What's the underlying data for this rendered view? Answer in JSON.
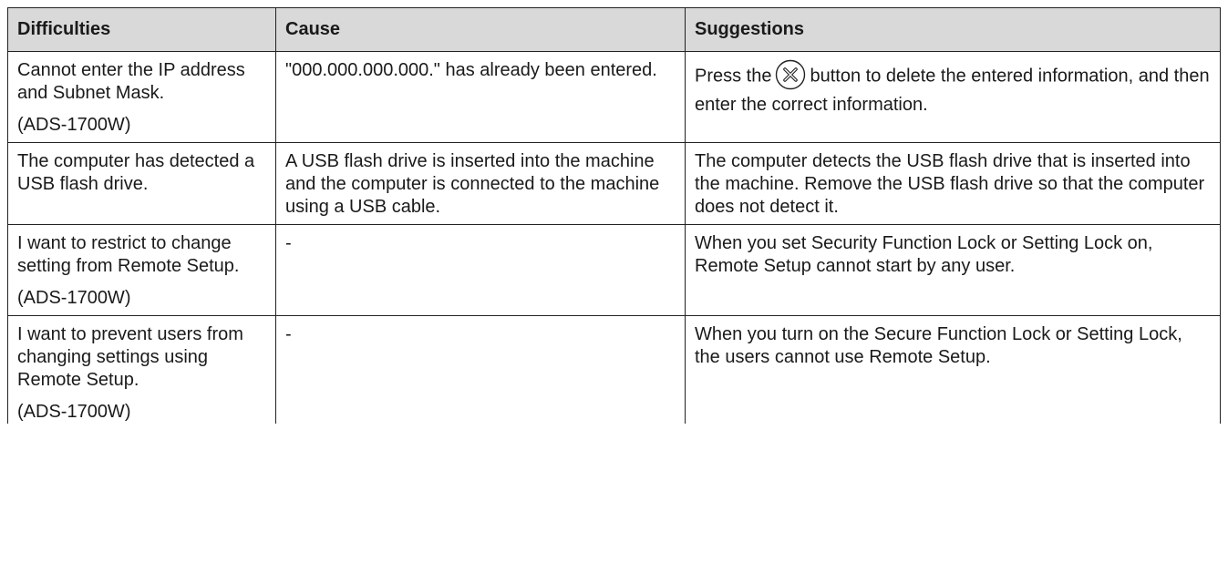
{
  "headers": {
    "difficulties": "Difficulties",
    "cause": "Cause",
    "suggestions": "Suggestions"
  },
  "rows": [
    {
      "difficulty": "Cannot enter the IP address and Subnet Mask.",
      "model": "(ADS-1700W)",
      "cause": "\"000.000.000.000.\" has already been entered.",
      "suggestion_before_icon": "Press the",
      "suggestion_icon": "stop-x-icon",
      "suggestion_after_icon": "button to delete the entered information, and then enter the correct information."
    },
    {
      "difficulty": "The computer has detected a USB flash drive.",
      "cause": "A USB flash drive is inserted into the machine and the computer is connected to the machine using a USB cable.",
      "suggestion": "The computer detects the USB flash drive that is inserted into the machine. Remove the USB flash drive so that the computer does not detect it."
    },
    {
      "difficulty": "I want to restrict to change setting from Remote Setup.",
      "model": "(ADS-1700W)",
      "cause": "-",
      "suggestion": "When you set Security Function Lock or Setting Lock on, Remote Setup cannot start by any user."
    },
    {
      "difficulty": "I want to prevent users from changing settings using Remote Setup.",
      "model": "(ADS-1700W)",
      "cause": "-",
      "suggestion": "When you turn on the Secure Function Lock or Setting Lock, the users cannot use Remote Setup."
    }
  ]
}
